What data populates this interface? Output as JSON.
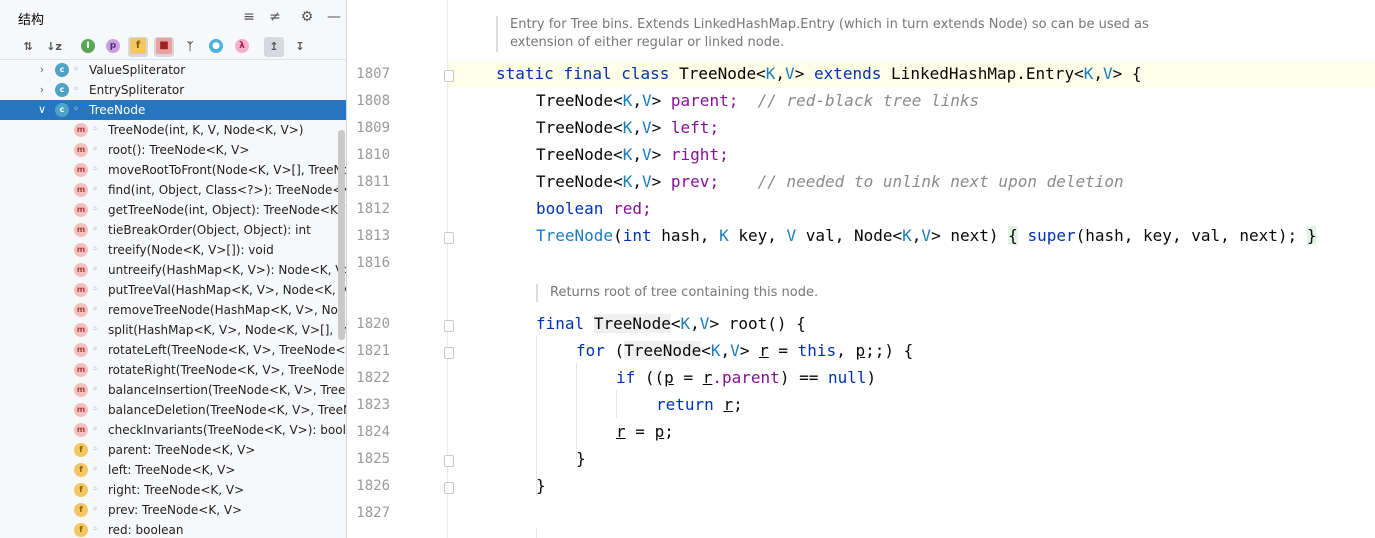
{
  "structure_panel": {
    "title": "结构",
    "header_icons": [
      "expand-all-icon",
      "collapse-all-icon",
      "settings-icon",
      "minimize-icon"
    ],
    "toolbar_icons": [
      "sort-by-visibility-icon",
      "sort-alphabetically-icon",
      "show-inherited-icon",
      "show-properties-icon",
      "show-fields-icon",
      "show-non-public-icon",
      "show-lambdas-icon",
      "show-anonymous-icon",
      "lambda-icon",
      "autoscroll-to-source-icon",
      "autoscroll-from-source-icon"
    ],
    "tree": [
      {
        "label": "ValueSpliterator",
        "kind": "class",
        "level": 1,
        "expanded": false
      },
      {
        "label": "EntrySpliterator",
        "kind": "class",
        "level": 1,
        "expanded": false
      },
      {
        "label": "TreeNode",
        "kind": "class",
        "level": 1,
        "expanded": true,
        "selected": true
      },
      {
        "label": "TreeNode(int, K, V, Node<K, V>)",
        "kind": "method",
        "level": 2
      },
      {
        "label": "root(): TreeNode<K, V>",
        "kind": "method",
        "level": 2
      },
      {
        "label": "moveRootToFront(Node<K, V>[], TreeNode<K, V>): void",
        "kind": "method",
        "level": 2
      },
      {
        "label": "find(int, Object, Class<?>): TreeNode<K, V>",
        "kind": "method",
        "level": 2
      },
      {
        "label": "getTreeNode(int, Object): TreeNode<K, V>",
        "kind": "method",
        "level": 2
      },
      {
        "label": "tieBreakOrder(Object, Object): int",
        "kind": "method",
        "level": 2
      },
      {
        "label": "treeify(Node<K, V>[]): void",
        "kind": "method",
        "level": 2
      },
      {
        "label": "untreeify(HashMap<K, V>): Node<K, V>",
        "kind": "method",
        "level": 2
      },
      {
        "label": "putTreeVal(HashMap<K, V>, Node<K, V>[], int, K, V): TreeNode<K, V>",
        "kind": "method",
        "level": 2
      },
      {
        "label": "removeTreeNode(HashMap<K, V>, Node<K, V>[], boolean): void",
        "kind": "method",
        "level": 2
      },
      {
        "label": "split(HashMap<K, V>, Node<K, V>[], int, int): void",
        "kind": "method",
        "level": 2
      },
      {
        "label": "rotateLeft(TreeNode<K, V>, TreeNode<K, V>): TreeNode<K, V>",
        "kind": "method",
        "level": 2
      },
      {
        "label": "rotateRight(TreeNode<K, V>, TreeNode<K, V>): TreeNode<K, V>",
        "kind": "method",
        "level": 2
      },
      {
        "label": "balanceInsertion(TreeNode<K, V>, TreeNode<K, V>): TreeNode<K, V>",
        "kind": "method",
        "level": 2
      },
      {
        "label": "balanceDeletion(TreeNode<K, V>, TreeNode<K, V>): TreeNode<K, V>",
        "kind": "method",
        "level": 2
      },
      {
        "label": "checkInvariants(TreeNode<K, V>): boolean",
        "kind": "method",
        "level": 2
      },
      {
        "label": "parent: TreeNode<K, V>",
        "kind": "field",
        "level": 2
      },
      {
        "label": "left: TreeNode<K, V>",
        "kind": "field",
        "level": 2
      },
      {
        "label": "right: TreeNode<K, V>",
        "kind": "field",
        "level": 2
      },
      {
        "label": "prev: TreeNode<K, V>",
        "kind": "field",
        "level": 2
      },
      {
        "label": "red: boolean",
        "kind": "field",
        "level": 2
      }
    ]
  },
  "editor": {
    "doc_comments": [
      {
        "lines": [
          "Entry for Tree bins. Extends LinkedHashMap.Entry (which in turn extends Node) so can be used as",
          "extension of either regular or linked node."
        ]
      },
      {
        "lines": [
          "Returns root of tree containing this node."
        ]
      }
    ],
    "line_numbers": [
      "1807",
      "1808",
      "1809",
      "1810",
      "1811",
      "1812",
      "1813",
      "1816",
      "1820",
      "1821",
      "1822",
      "1823",
      "1824",
      "1825",
      "1826",
      "1827"
    ],
    "code": {
      "l1807": {
        "kw1": "static",
        "kw2": "final",
        "kw3": "class",
        "name": "TreeNode",
        "lt": "<",
        "k": "K",
        "comma": ",",
        "v": "V",
        "gt": ">",
        "kw4": "extends",
        "parent": "LinkedHashMap.Entry",
        "lt2": "<",
        "k2": "K",
        "comma2": ",",
        "v2": "V",
        "gt2": ">",
        "brace": "{"
      },
      "l1808": {
        "type": "TreeNode<",
        "k": "K",
        "c": ",",
        "v": "V",
        "gt": ">",
        "field": "parent;",
        "comment": "// red-black tree links"
      },
      "l1809": {
        "type": "TreeNode<",
        "k": "K",
        "c": ",",
        "v": "V",
        "gt": ">",
        "field": "left;"
      },
      "l1810": {
        "type": "TreeNode<",
        "k": "K",
        "c": ",",
        "v": "V",
        "gt": ">",
        "field": "right;"
      },
      "l1811": {
        "type": "TreeNode<",
        "k": "K",
        "c": ",",
        "v": "V",
        "gt": ">",
        "field": "prev;",
        "comment": "// needed to unlink next upon deletion"
      },
      "l1812": {
        "kw": "boolean",
        "field": "red;"
      },
      "l1813": {
        "ctor": "TreeNode",
        "p1": "(",
        "kwint": "int",
        "hash": "hash,",
        "k": "K",
        "key": "key,",
        "v": "V",
        "val": "val,",
        "node": "Node<",
        "k2": "K",
        "c": ",",
        "v2": "V",
        "gt": ">",
        "next": "next)",
        "ob": "{",
        "sup": "super",
        "args": "(hash, key, val, next);",
        "cb": "}"
      },
      "l1820": {
        "kw": "final",
        "type": "TreeNode",
        "lt": "<",
        "k": "K",
        "c": ",",
        "v": "V",
        "gt": ">",
        "method": "root() {"
      },
      "l1821": {
        "kw": "for",
        "open": "(",
        "type": "TreeNode",
        "lt": "<",
        "k": "K",
        "c": ",",
        "v": "V",
        "gt": ">",
        "r": "r",
        "eq": "=",
        "this": "this",
        "comma": ",",
        "p": "p",
        "rest": ";;) {"
      },
      "l1822": {
        "kw": "if",
        "open": "((",
        "p": "p",
        "eq": "=",
        "r": "r",
        "field": ".parent",
        "rest": ") ==",
        "null": "null",
        "close": ")"
      },
      "l1823": {
        "kw": "return",
        "r": "r",
        "semi": ";"
      },
      "l1824": {
        "r": "r",
        "eq": "=",
        "p": "p",
        "semi": ";"
      },
      "l1825": {
        "brace": "}"
      },
      "l1826": {
        "brace": "}"
      }
    }
  }
}
